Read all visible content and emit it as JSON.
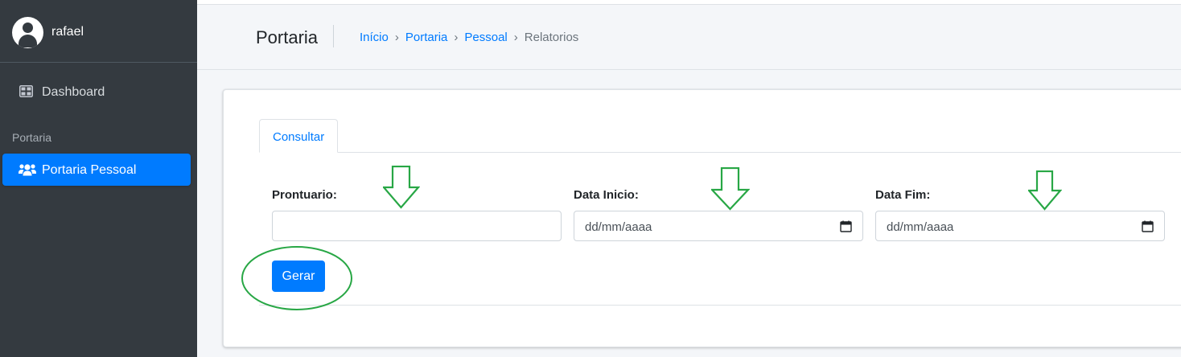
{
  "sidebar": {
    "user": {
      "name": "rafael",
      "icon": "user-circle-icon"
    },
    "items": [
      {
        "label": "Dashboard",
        "icon": "dashboard-grid-icon",
        "active": false
      }
    ],
    "section_header": "Portaria",
    "section_items": [
      {
        "label": "Portaria Pessoal",
        "icon": "users-icon",
        "active": true
      }
    ]
  },
  "header": {
    "title": "Portaria",
    "breadcrumb": [
      "Início",
      "Portaria",
      "Pessoal",
      "Relatorios"
    ]
  },
  "tabs": [
    {
      "label": "Consultar",
      "active": true
    }
  ],
  "form": {
    "fields": [
      {
        "label": "Prontuario:",
        "value": "",
        "placeholder": ""
      },
      {
        "label": "Data Inicio:",
        "value": "",
        "placeholder": "dd/mm/aaaa"
      },
      {
        "label": "Data Fim:",
        "value": "",
        "placeholder": "dd/mm/aaaa"
      }
    ],
    "submit_label": "Gerar"
  },
  "colors": {
    "sidebar_bg": "#343a40",
    "primary": "#007bff",
    "annotation": "#28a745"
  }
}
